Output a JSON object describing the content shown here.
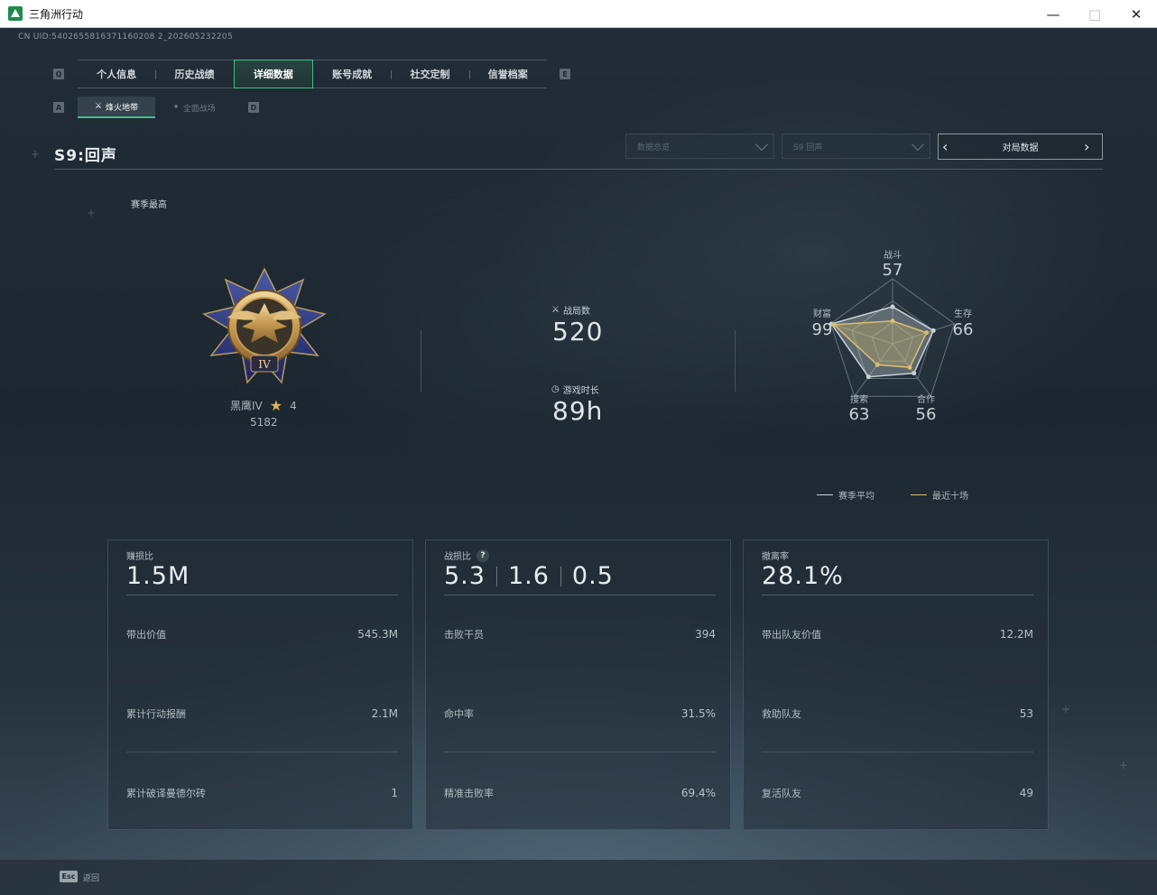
{
  "window": {
    "title": "三角洲行动"
  },
  "header": {
    "uid": "CN UID:5402655816371160208 2_202605232205",
    "main_tabs": [
      "个人信息",
      "历史战绩",
      "详细数据",
      "账号成就",
      "社交定制",
      "信誉档案"
    ],
    "active_main_tab": "详细数据",
    "keyhint_left": "Q",
    "keyhint_right": "E",
    "sub_keyhint_left": "A",
    "sub_keyhint_right": "D",
    "sub_tabs": [
      "烽火地带",
      "全面战场"
    ],
    "active_sub_tab": "烽火地带"
  },
  "season": {
    "title": "S9:回声",
    "dropdown_1": "数据总览",
    "dropdown_2": "S9 回声",
    "match_nav_label": "对局数据",
    "season_best_label": "赛季最高"
  },
  "rank": {
    "name": "黑鹰IV",
    "stars": "4",
    "score": "5182",
    "roman": "IV"
  },
  "summary": {
    "matches_label": "战局数",
    "matches_value": "520",
    "playtime_label": "游戏时长",
    "playtime_value": "89h"
  },
  "radar": {
    "axes": [
      {
        "label": "战斗",
        "value": "57"
      },
      {
        "label": "生存",
        "value": "66"
      },
      {
        "label": "合作",
        "value": "56"
      },
      {
        "label": "搜索",
        "value": "63"
      },
      {
        "label": "财富",
        "value": "99"
      }
    ],
    "season_avg_values": [
      57,
      66,
      56,
      63,
      99
    ],
    "recent_ten_values": [
      35,
      55,
      45,
      40,
      95
    ],
    "legend_season_avg": "赛季平均",
    "legend_recent_ten": "最近十场",
    "color_season_avg": "#c9d1d6",
    "color_recent_ten": "#d8c070"
  },
  "cards": [
    {
      "label": "赚损比",
      "big_values": [
        "1.5M"
      ],
      "help": "",
      "rows": [
        {
          "label": "带出价值",
          "value": "545.3M"
        },
        {
          "label": "累计行动报酬",
          "value": "2.1M"
        },
        {
          "label": "累计破译曼德尔砖",
          "value": "1"
        }
      ]
    },
    {
      "label": "战损比",
      "big_values": [
        "5.3",
        "1.6",
        "0.5"
      ],
      "help": "?",
      "rows": [
        {
          "label": "击败干员",
          "value": "394"
        },
        {
          "label": "命中率",
          "value": "31.5%"
        },
        {
          "label": "精准击败率",
          "value": "69.4%"
        }
      ]
    },
    {
      "label": "撤离率",
      "big_values": [
        "28.1%"
      ],
      "help": "",
      "rows": [
        {
          "label": "带出队友价值",
          "value": "12.2M"
        },
        {
          "label": "救助队友",
          "value": "53"
        },
        {
          "label": "复活队友",
          "value": "49"
        }
      ]
    }
  ],
  "footer": {
    "esc_key": "Esc",
    "esc_label": "返回"
  }
}
